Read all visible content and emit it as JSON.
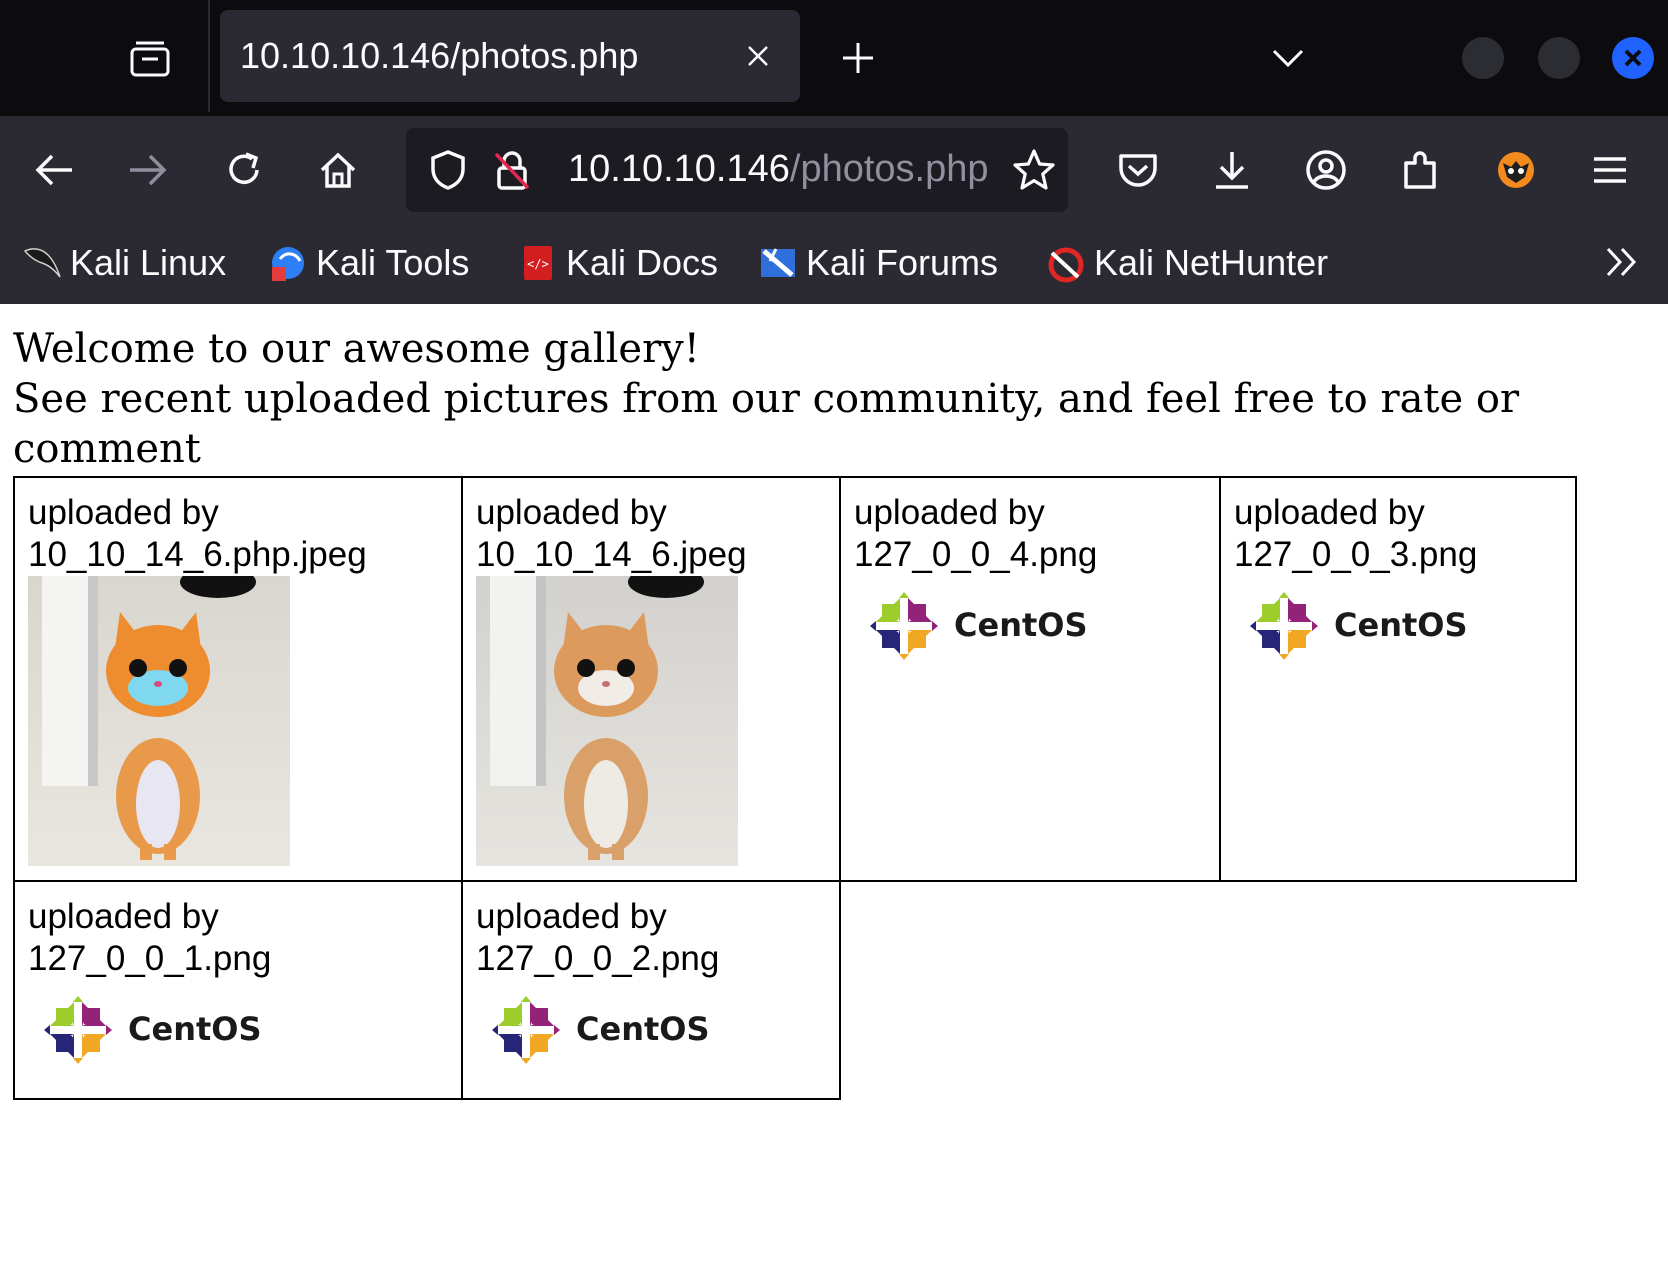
{
  "browser": {
    "tab": {
      "title": "10.10.10.146/photos.php"
    },
    "url": {
      "host": "10.10.10.146",
      "path": "/photos.php"
    },
    "bookmarks": [
      {
        "label": "Kali Linux",
        "icon": "kali-dragon-icon"
      },
      {
        "label": "Kali Tools",
        "icon": "kali-tools-icon"
      },
      {
        "label": "Kali Docs",
        "icon": "kali-docs-icon"
      },
      {
        "label": "Kali Forums",
        "icon": "kali-forums-icon"
      },
      {
        "label": "Kali NetHunter",
        "icon": "kali-nethunter-icon"
      }
    ],
    "colors": {
      "chrome_dark": "#0c0c0e",
      "chrome": "#2b2a33",
      "urlbar": "#1c1b22",
      "close_button": "#1f62ff"
    }
  },
  "page": {
    "intro_line1": "Welcome to our awesome gallery!",
    "intro_line2": "See recent uploaded pictures from our community, and feel free to rate or comment",
    "gallery": [
      {
        "caption_prefix": "uploaded by",
        "filename": "10_10_14_6.php.jpeg",
        "image": "kitten-photo-distorted"
      },
      {
        "caption_prefix": "uploaded by",
        "filename": "10_10_14_6.jpeg",
        "image": "kitten-photo"
      },
      {
        "caption_prefix": "uploaded by",
        "filename": "127_0_0_4.png",
        "image": "centos-logo",
        "logo_text": "CentOS"
      },
      {
        "caption_prefix": "uploaded by",
        "filename": "127_0_0_3.png",
        "image": "centos-logo",
        "logo_text": "CentOS"
      },
      {
        "caption_prefix": "uploaded by",
        "filename": "127_0_0_1.png",
        "image": "centos-logo",
        "logo_text": "CentOS"
      },
      {
        "caption_prefix": "uploaded by",
        "filename": "127_0_0_2.png",
        "image": "centos-logo",
        "logo_text": "CentOS"
      }
    ]
  }
}
